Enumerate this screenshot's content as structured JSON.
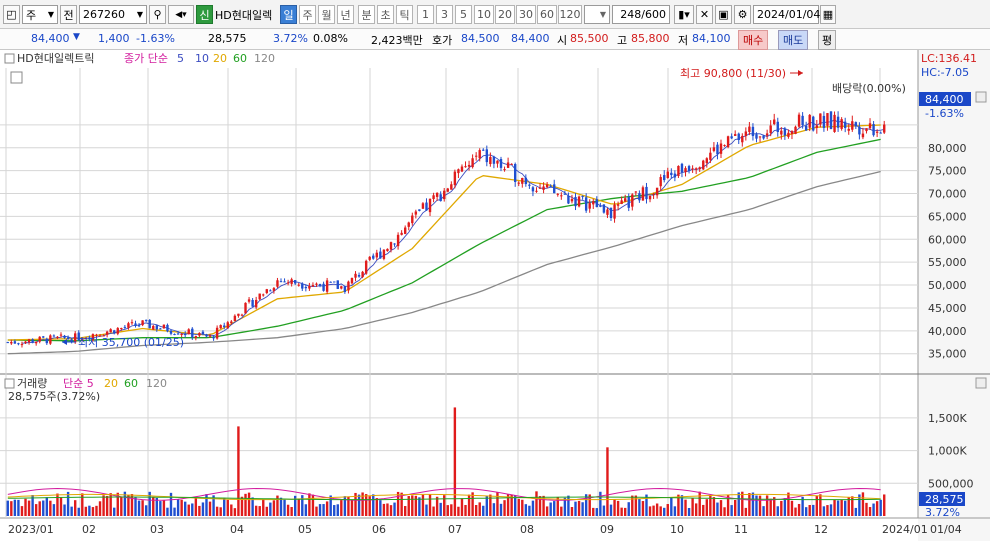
{
  "toolbar": {
    "market": "주",
    "prefix": "전",
    "code": "267260",
    "badge": "신",
    "name": "HD현대일렉",
    "periods": [
      "일",
      "주",
      "월",
      "년",
      "분",
      "초",
      "틱"
    ],
    "numbers": [
      "1",
      "3",
      "5",
      "10",
      "20",
      "30",
      "60",
      "120"
    ],
    "count": "248",
    "count_total": "/600",
    "date": "2024/01/04"
  },
  "quote": {
    "price": "84,400",
    "change": "1,400",
    "change_pct": "-1.63%",
    "volume": "28,575",
    "volume_pct": "3.72%",
    "turnover": "0.08%",
    "amount": "2,423백만",
    "ask_label": "호가",
    "ask1": "84,500",
    "ask2": "84,400",
    "open_label": "시",
    "open": "85,500",
    "high_label": "고",
    "high": "85,800",
    "low_label": "저",
    "low": "84,100",
    "buy_label": "매수",
    "sell_label": "매도",
    "eval_label": "평"
  },
  "chart_data": [
    {
      "type": "candlestick",
      "title": "HD현대일렉트릭",
      "legend": [
        {
          "name": "종가 단순",
          "color": "#d21c9e"
        },
        {
          "name": "5",
          "color": "#3b4cc0"
        },
        {
          "name": "10",
          "color": "#3b4cc0"
        },
        {
          "name": "20",
          "color": "#e0a800"
        },
        {
          "name": "60",
          "color": "#22a022"
        },
        {
          "name": "120",
          "color": "#888888"
        }
      ],
      "ylim": [
        31000,
        97000
      ],
      "yticks": [
        35000,
        40000,
        45000,
        50000,
        55000,
        60000,
        65000,
        70000,
        75000,
        80000,
        85000
      ],
      "ytick_labels": [
        "35,000",
        "40,000",
        "45,000",
        "50,000",
        "55,000",
        "60,000",
        "65,000",
        "70,000",
        "75,000",
        "80,000"
      ],
      "months": [
        "2023/01",
        "02",
        "03",
        "04",
        "05",
        "06",
        "07",
        "08",
        "09",
        "10",
        "11",
        "12",
        "2024/01"
      ],
      "close_monthly": [
        37500,
        38500,
        41500,
        38500,
        51000,
        49500,
        64000,
        78500,
        70500,
        66000,
        75500,
        83500,
        85800,
        84400
      ],
      "ma20": [
        38000,
        38300,
        40500,
        39000,
        47000,
        48500,
        58000,
        74000,
        72000,
        67500,
        72000,
        80500,
        84500,
        85000
      ],
      "ma60": [
        38000,
        37800,
        38500,
        38500,
        41000,
        44500,
        50500,
        59000,
        66500,
        69000,
        70500,
        73500,
        79000,
        82000
      ],
      "ma120": [
        35000,
        35500,
        36800,
        37500,
        38500,
        40500,
        44000,
        48500,
        54500,
        58500,
        63000,
        66500,
        71500,
        75000
      ],
      "annotations": {
        "high": "최고 90,800 (11/30)",
        "low": "최저 35,700 (01/25)",
        "dividend": "배당락(0.00%)",
        "lc": "LC:136.41",
        "hc": "HC:-7.05",
        "last_price": "84,400",
        "last_pct": "-1.63%"
      }
    },
    {
      "type": "bar",
      "title": "거래량",
      "legend": [
        {
          "name": "단순 5",
          "color": "#d21c9e"
        },
        {
          "name": "20",
          "color": "#e0a800"
        },
        {
          "name": "60",
          "color": "#22a022"
        },
        {
          "name": "120",
          "color": "#888888"
        }
      ],
      "info": "28,575주(3.72%)",
      "ylim": [
        0,
        1850000
      ],
      "yticks": [
        500000,
        1000000,
        1500000
      ],
      "ytick_labels": [
        "500,000",
        "1,000K",
        "1,500K"
      ],
      "spikes": [
        {
          "month": "04",
          "value": 1370000
        },
        {
          "month": "07",
          "value": 1660000
        },
        {
          "month": "09",
          "value": 1050000
        },
        {
          "month": "01",
          "value": 770000
        }
      ],
      "last_volume": "28,575",
      "last_pct": "3.72%",
      "x_end_label": "01/04"
    }
  ],
  "icons": {
    "colors": {
      "up": "#e01b1b",
      "down": "#1f4fd0",
      "grid": "#d6d6d6"
    }
  }
}
